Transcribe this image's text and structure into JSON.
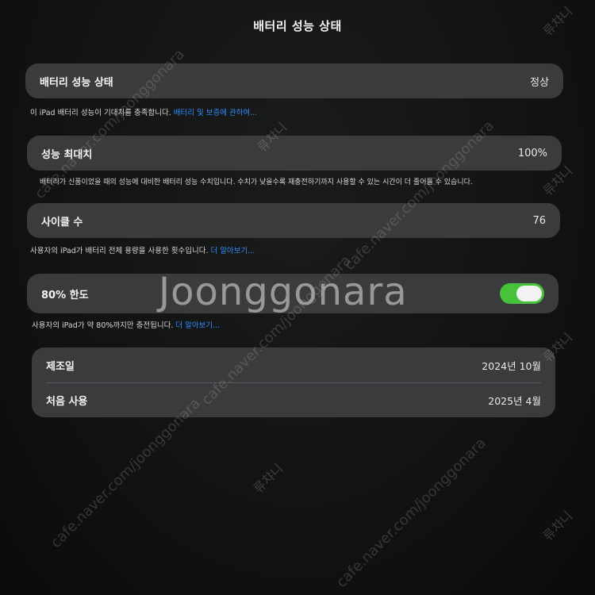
{
  "header": {
    "title": "배터리 성능 상태"
  },
  "battery_health": {
    "label": "배터리 성능 상태",
    "value": "정상",
    "note": "이 iPad 배터리 성능이 기대치를 충족합니다.",
    "note_link": "배터리 및 보증에 관하여..."
  },
  "max_capacity": {
    "label": "성능 최대치",
    "value": "100%",
    "note": "배터리가 신품이었을 때의 성능에 대비한 배터리 성능 수치입니다. 수치가 낮을수록 재충전하기까지 사용할 수 있는 시간이 더 줄어들 수 있습니다."
  },
  "cycle_count": {
    "label": "사이클 수",
    "value": "76",
    "note": "사용자의 iPad가 배터리 전체 용량을 사용한 횟수입니다.",
    "note_link": "더 알아보기..."
  },
  "limit_80": {
    "label": "80% 한도",
    "enabled": true,
    "note": "사용자의 iPad가 약 80%까지만 충전됩니다.",
    "note_link": "더 알아보기..."
  },
  "dates": {
    "manufacture_label": "제조일",
    "manufacture_value": "2024년 10월",
    "first_use_label": "처음 사용",
    "first_use_value": "2025년 4월"
  },
  "watermark": {
    "brand": "Joonggonara",
    "url": "cafe.naver.com/joonggonara",
    "user": "류챠니"
  },
  "colors": {
    "accent_link": "#2f8cff",
    "toggle_on": "#49c23b",
    "card_bg": "#3a3b3c"
  }
}
